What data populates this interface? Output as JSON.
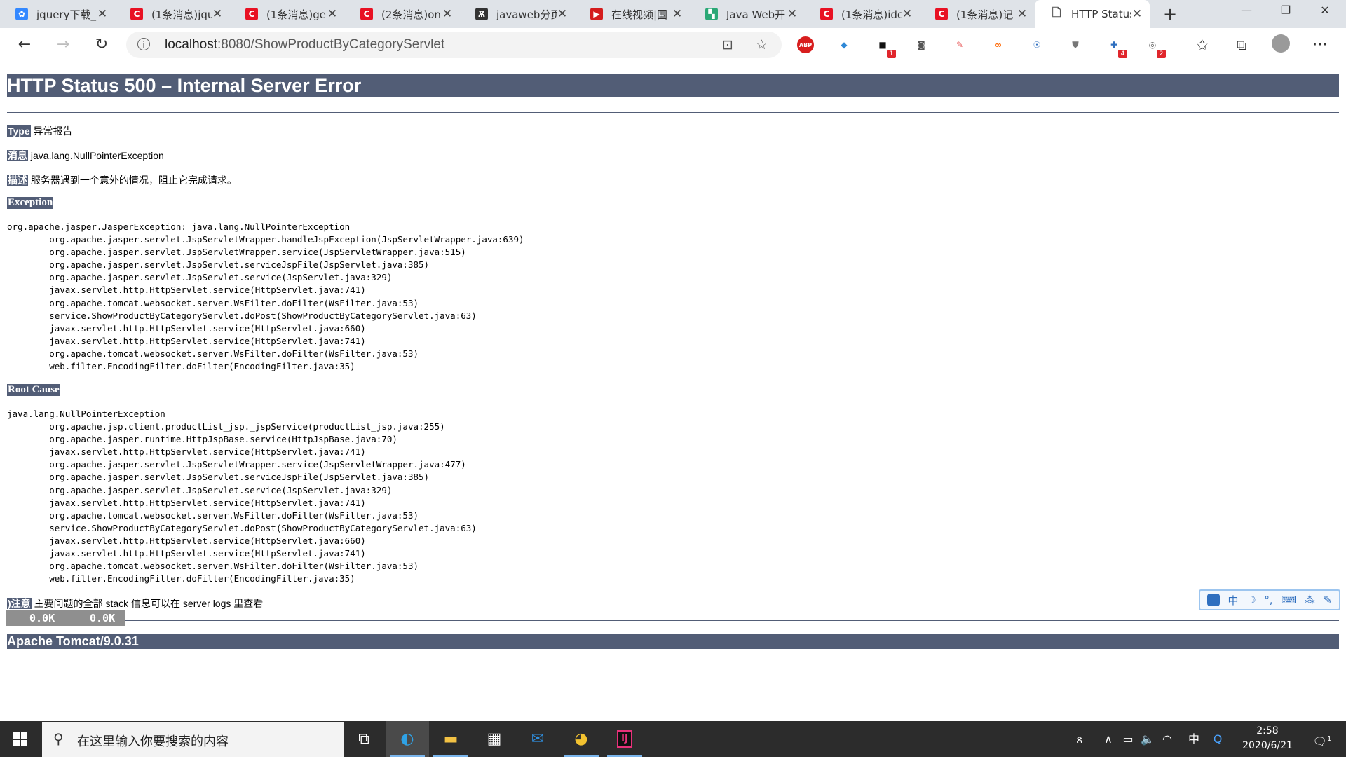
{
  "browser": {
    "tabs": [
      {
        "label": "jquery下载_",
        "favicon": "baidu",
        "color": "#3388ff",
        "glyph": "✿"
      },
      {
        "label": "(1条消息)jqu",
        "favicon": "csdn",
        "color": "#e81123",
        "glyph": "C"
      },
      {
        "label": "(1条消息)ge",
        "favicon": "csdn",
        "color": "#e81123",
        "glyph": "C"
      },
      {
        "label": "(2条消息)on",
        "favicon": "csdn",
        "color": "#e81123",
        "glyph": "C"
      },
      {
        "label": "javaweb分页",
        "favicon": "yuque",
        "color": "#333333",
        "glyph": "Ѫ"
      },
      {
        "label": "在线视频|国",
        "favicon": "video",
        "color": "#d41c1c",
        "glyph": "▶"
      },
      {
        "label": "Java Web开",
        "favicon": "book",
        "color": "#2aa876",
        "glyph": "▚"
      },
      {
        "label": "(1条消息)ide",
        "favicon": "csdn",
        "color": "#e81123",
        "glyph": "C"
      },
      {
        "label": "(1条消息)记",
        "favicon": "csdn",
        "color": "#e81123",
        "glyph": "C"
      },
      {
        "label": "HTTP Status",
        "favicon": "document",
        "color": "#555555",
        "glyph": "🗋",
        "active": true
      }
    ],
    "new_tab": "+",
    "window_controls": [
      "—",
      "❐",
      "✕"
    ],
    "address": {
      "host": "localhost",
      "rest": ":8080/ShowProductByCategoryServlet"
    },
    "extensions": [
      {
        "name": "adblock-plus-icon",
        "glyph": "ABP",
        "bg": "#d81e1e",
        "fg": "#fff",
        "badge": ""
      },
      {
        "name": "shield-heart-icon",
        "glyph": "◆",
        "bg": "#ffffff",
        "fg": "#2e88d6",
        "badge": ""
      },
      {
        "name": "notes-icon",
        "glyph": "■",
        "bg": "#ffffff",
        "fg": "#111",
        "badge": "1"
      },
      {
        "name": "camera-icon",
        "glyph": "◙",
        "bg": "#ffffff",
        "fg": "#555",
        "badge": ""
      },
      {
        "name": "pen-icon",
        "glyph": "✎",
        "bg": "#ffffff",
        "fg": "#e85a5a",
        "badge": ""
      },
      {
        "name": "infinity-icon",
        "glyph": "∞",
        "bg": "#ffffff",
        "fg": "#ff6600",
        "badge": ""
      },
      {
        "name": "owl-icon",
        "glyph": "☉",
        "bg": "#ffffff",
        "fg": "#2f6fbf",
        "badge": ""
      },
      {
        "name": "shield-icon",
        "glyph": "⛊",
        "bg": "#ffffff",
        "fg": "#777",
        "badge": ""
      },
      {
        "name": "puzzle-icon",
        "glyph": "✚",
        "bg": "#ffffff",
        "fg": "#2f6fbf",
        "badge": "4"
      },
      {
        "name": "globe-icon",
        "glyph": "◎",
        "bg": "#ffffff",
        "fg": "#555",
        "badge": "2"
      }
    ]
  },
  "error_page": {
    "title": "HTTP Status 500 – Internal Server Error",
    "type_label": "Type",
    "type_value": "异常报告",
    "message_label": "消息",
    "message_value": "java.lang.NullPointerException",
    "description_label": "描述",
    "description_value": "服务器遇到一个意外的情况，阻止它完成请求。",
    "exception_heading": "Exception",
    "exception_trace": "org.apache.jasper.JasperException: java.lang.NullPointerException\n\torg.apache.jasper.servlet.JspServletWrapper.handleJspException(JspServletWrapper.java:639)\n\torg.apache.jasper.servlet.JspServletWrapper.service(JspServletWrapper.java:515)\n\torg.apache.jasper.servlet.JspServlet.serviceJspFile(JspServlet.java:385)\n\torg.apache.jasper.servlet.JspServlet.service(JspServlet.java:329)\n\tjavax.servlet.http.HttpServlet.service(HttpServlet.java:741)\n\torg.apache.tomcat.websocket.server.WsFilter.doFilter(WsFilter.java:53)\n\tservice.ShowProductByCategoryServlet.doPost(ShowProductByCategoryServlet.java:63)\n\tjavax.servlet.http.HttpServlet.service(HttpServlet.java:660)\n\tjavax.servlet.http.HttpServlet.service(HttpServlet.java:741)\n\torg.apache.tomcat.websocket.server.WsFilter.doFilter(WsFilter.java:53)\n\tweb.filter.EncodingFilter.doFilter(EncodingFilter.java:35)",
    "root_cause_heading": "Root Cause",
    "root_cause_trace": "java.lang.NullPointerException\n\torg.apache.jsp.client.productList_jsp._jspService(productList_jsp.java:255)\n\torg.apache.jasper.runtime.HttpJspBase.service(HttpJspBase.java:70)\n\tjavax.servlet.http.HttpServlet.service(HttpServlet.java:741)\n\torg.apache.jasper.servlet.JspServletWrapper.service(JspServletWrapper.java:477)\n\torg.apache.jasper.servlet.JspServlet.serviceJspFile(JspServlet.java:385)\n\torg.apache.jasper.servlet.JspServlet.service(JspServlet.java:329)\n\tjavax.servlet.http.HttpServlet.service(HttpServlet.java:741)\n\torg.apache.tomcat.websocket.server.WsFilter.doFilter(WsFilter.java:53)\n\tservice.ShowProductByCategoryServlet.doPost(ShowProductByCategoryServlet.java:63)\n\tjavax.servlet.http.HttpServlet.service(HttpServlet.java:660)\n\tjavax.servlet.http.HttpServlet.service(HttpServlet.java:741)\n\torg.apache.tomcat.websocket.server.WsFilter.doFilter(WsFilter.java:53)\n\tweb.filter.EncodingFilter.doFilter(EncodingFilter.java:35)",
    "note_label": ")注意",
    "note_value": "主要问题的全部 stack 信息可以在 server logs 里查看",
    "footer": "Apache Tomcat/9.0.31"
  },
  "net_speed": {
    "up": "0.0K",
    "down": "0.0K"
  },
  "ime_toolbar": [
    "中",
    "☽",
    "°,",
    "⌨",
    "⁂",
    "✎"
  ],
  "taskbar": {
    "search_placeholder": "在这里输入你要搜索的内容",
    "apps": [
      {
        "name": "task-view-icon",
        "glyph": "⧉",
        "color": "#ffffff",
        "running": false,
        "active": false
      },
      {
        "name": "edge-icon",
        "glyph": "◐",
        "color": "#2fa2e6",
        "running": true,
        "active": true
      },
      {
        "name": "file-explorer-icon",
        "glyph": "▬",
        "color": "#f3c244",
        "running": true,
        "active": false
      },
      {
        "name": "store-icon",
        "glyph": "▦",
        "color": "#ffffff",
        "running": false,
        "active": false
      },
      {
        "name": "mail-icon",
        "glyph": "✉",
        "color": "#2f8fe0",
        "running": false,
        "active": false
      },
      {
        "name": "chat-icon",
        "glyph": "◕",
        "color": "#f2c230",
        "running": true,
        "active": false
      },
      {
        "name": "intellij-icon",
        "glyph": "IJ",
        "color": "#e8317a",
        "running": true,
        "active": false
      }
    ],
    "tray": [
      "ጸ",
      "∧",
      "▭",
      "🔈",
      "◠",
      "中",
      "Q"
    ],
    "time": "2:58",
    "date": "2020/6/21",
    "notification_count": "1"
  }
}
